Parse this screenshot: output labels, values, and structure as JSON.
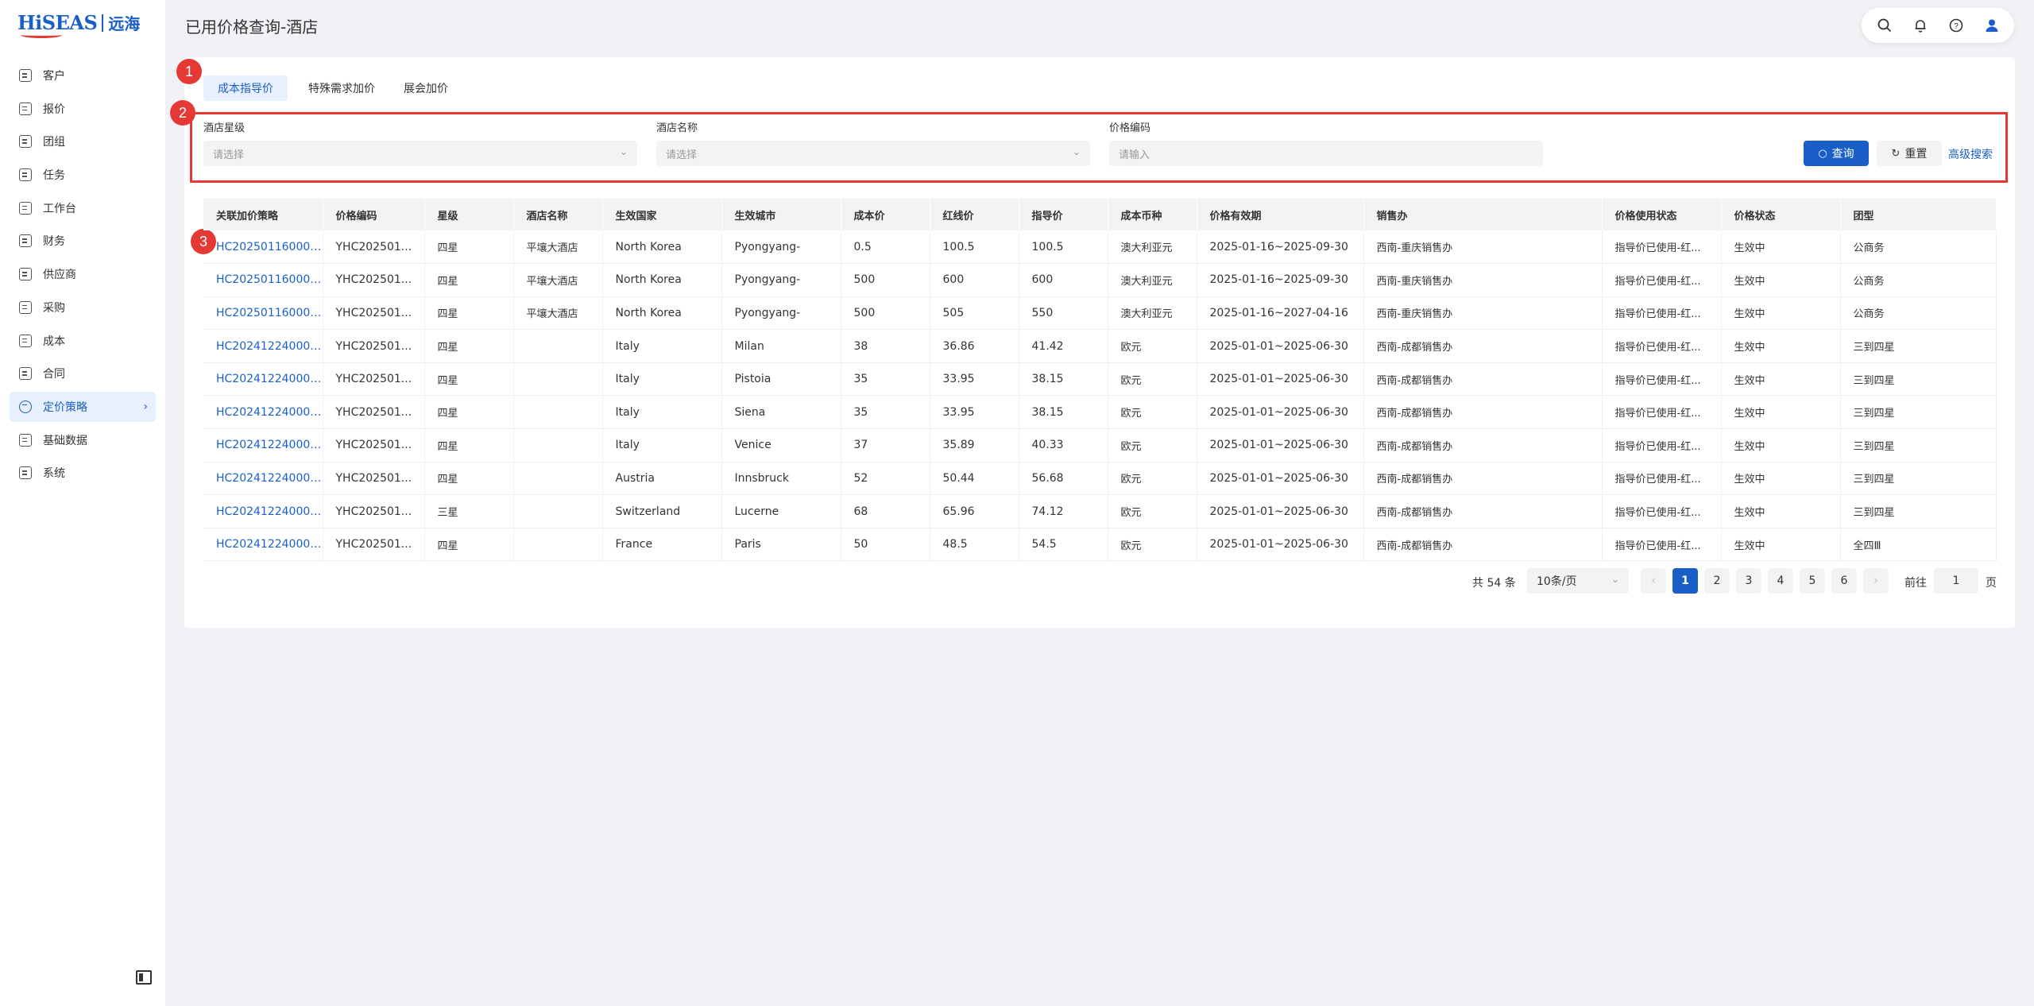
{
  "app": {
    "logo_text": "HiSEAS",
    "logo_cn": "远海"
  },
  "page": {
    "title": "已用价格查询-酒店"
  },
  "sidebar": {
    "items": [
      {
        "label": "客户",
        "icon": "customer-icon"
      },
      {
        "label": "报价",
        "icon": "quote-icon"
      },
      {
        "label": "团组",
        "icon": "group-icon"
      },
      {
        "label": "任务",
        "icon": "task-icon"
      },
      {
        "label": "工作台",
        "icon": "workbench-icon"
      },
      {
        "label": "财务",
        "icon": "finance-icon"
      },
      {
        "label": "供应商",
        "icon": "supplier-icon"
      },
      {
        "label": "采购",
        "icon": "purchase-icon"
      },
      {
        "label": "成本",
        "icon": "cost-icon"
      },
      {
        "label": "合同",
        "icon": "contract-icon"
      },
      {
        "label": "定价策略",
        "icon": "pricing-icon",
        "active": true
      },
      {
        "label": "基础数据",
        "icon": "basedata-icon"
      },
      {
        "label": "系统",
        "icon": "settings-icon"
      }
    ]
  },
  "tabs": [
    {
      "label": "成本指导价",
      "active": true
    },
    {
      "label": "特殊需求加价"
    },
    {
      "label": "展会加价"
    }
  ],
  "badges": [
    "1",
    "2",
    "3"
  ],
  "filters": {
    "star": {
      "label": "酒店星级",
      "placeholder": "请选择"
    },
    "hotel": {
      "label": "酒店名称",
      "placeholder": "请选择"
    },
    "code": {
      "label": "价格编码",
      "placeholder": "请输入"
    },
    "search_btn": "查询",
    "reset_btn": "重置",
    "advanced": "高级搜索"
  },
  "table": {
    "columns": [
      "关联加价策略",
      "价格编码",
      "星级",
      "酒店名称",
      "生效国家",
      "生效城市",
      "成本价",
      "红线价",
      "指导价",
      "成本币种",
      "价格有效期",
      "销售办",
      "价格使用状态",
      "价格状态",
      "团型"
    ],
    "rows": [
      [
        "HC202501160002...",
        "YHC202501...",
        "四星",
        "平壤大酒店",
        "North Korea",
        "Pyongyang-",
        "0.5",
        "100.5",
        "100.5",
        "澳大利亚元",
        "2025-01-16~2025-09-30",
        "西南-重庆销售办",
        "指导价已使用-红...",
        "生效中",
        "公商务"
      ],
      [
        "HC202501160002...",
        "YHC202501...",
        "四星",
        "平壤大酒店",
        "North Korea",
        "Pyongyang-",
        "500",
        "600",
        "600",
        "澳大利亚元",
        "2025-01-16~2025-09-30",
        "西南-重庆销售办",
        "指导价已使用-红...",
        "生效中",
        "公商务"
      ],
      [
        "HC202501160001...",
        "YHC202501...",
        "四星",
        "平壤大酒店",
        "North Korea",
        "Pyongyang-",
        "500",
        "505",
        "550",
        "澳大利亚元",
        "2025-01-16~2027-04-16",
        "西南-重庆销售办",
        "指导价已使用-红...",
        "生效中",
        "公商务"
      ],
      [
        "HC202412240001...",
        "YHC202501...",
        "四星",
        "",
        "Italy",
        "Milan",
        "38",
        "36.86",
        "41.42",
        "欧元",
        "2025-01-01~2025-06-30",
        "西南-成都销售办",
        "指导价已使用-红...",
        "生效中",
        "三到四星"
      ],
      [
        "HC202412240001...",
        "YHC202501...",
        "四星",
        "",
        "Italy",
        "Pistoia",
        "35",
        "33.95",
        "38.15",
        "欧元",
        "2025-01-01~2025-06-30",
        "西南-成都销售办",
        "指导价已使用-红...",
        "生效中",
        "三到四星"
      ],
      [
        "HC202412240001...",
        "YHC202501...",
        "四星",
        "",
        "Italy",
        "Siena",
        "35",
        "33.95",
        "38.15",
        "欧元",
        "2025-01-01~2025-06-30",
        "西南-成都销售办",
        "指导价已使用-红...",
        "生效中",
        "三到四星"
      ],
      [
        "HC202412240001...",
        "YHC202501...",
        "四星",
        "",
        "Italy",
        "Venice",
        "37",
        "35.89",
        "40.33",
        "欧元",
        "2025-01-01~2025-06-30",
        "西南-成都销售办",
        "指导价已使用-红...",
        "生效中",
        "三到四星"
      ],
      [
        "HC202412240001...",
        "YHC202501...",
        "四星",
        "",
        "Austria",
        "Innsbruck",
        "52",
        "50.44",
        "56.68",
        "欧元",
        "2025-01-01~2025-06-30",
        "西南-成都销售办",
        "指导价已使用-红...",
        "生效中",
        "三到四星"
      ],
      [
        "HC202412240001...",
        "YHC202501...",
        "三星",
        "",
        "Switzerland",
        "Lucerne",
        "68",
        "65.96",
        "74.12",
        "欧元",
        "2025-01-01~2025-06-30",
        "西南-成都销售办",
        "指导价已使用-红...",
        "生效中",
        "三到四星"
      ],
      [
        "HC202412240001...",
        "YHC202501...",
        "四星",
        "",
        "France",
        "Paris",
        "50",
        "48.5",
        "54.5",
        "欧元",
        "2025-01-01~2025-06-30",
        "西南-成都销售办",
        "指导价已使用-红...",
        "生效中",
        "全四Ⅲ"
      ]
    ]
  },
  "pagination": {
    "total": "共 54 条",
    "page_size": "10条/页",
    "pages": [
      "1",
      "2",
      "3",
      "4",
      "5",
      "6"
    ],
    "current": "1",
    "prev": "‹",
    "next": "›",
    "goto_label": "前往",
    "goto_value": "1",
    "goto_unit": "页"
  },
  "colors": {
    "accent": "#1a5fc8",
    "highlight_red": "#e53935",
    "active_bg": "#e8f0fe"
  }
}
